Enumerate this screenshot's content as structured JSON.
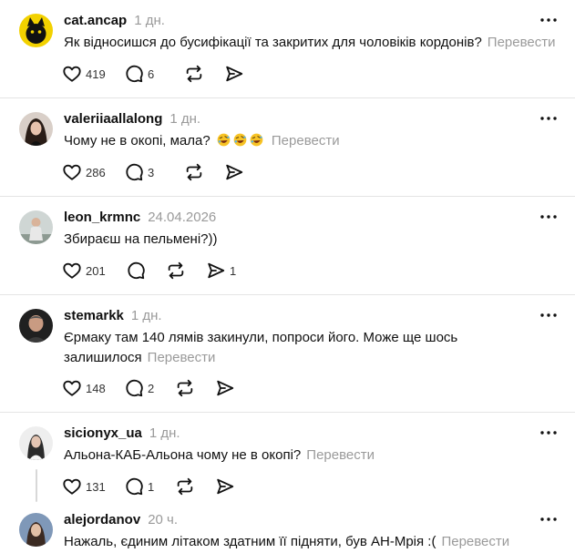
{
  "translate_label": "Перевести",
  "posts": [
    {
      "username": "cat.ancap",
      "time": "1 дн.",
      "text": "Як відносишся до бусифікації та закритих для чоловіків кордонів?",
      "likes": "419",
      "replies": "6",
      "shares": ""
    },
    {
      "username": "valeriiaallalong",
      "time": "1 дн.",
      "text": "Чому не в окопі, мала?",
      "emojis": [
        "rolling-laughing-emoji",
        "rolling-laughing-emoji",
        "rolling-laughing-emoji"
      ],
      "likes": "286",
      "replies": "3",
      "shares": ""
    },
    {
      "username": "leon_krmnc",
      "time": "24.04.2026",
      "text": "Збираєш на пельмені?))",
      "likes": "201",
      "replies": "",
      "shares": "1"
    },
    {
      "username": "stemarkk",
      "time": "1 дн.",
      "text_line1": "Єрмаку там 140 лямів закинули, попроси його. Може ще шось",
      "text_line2": "залишилося",
      "likes": "148",
      "replies": "2",
      "shares": ""
    },
    {
      "username": "sicionyx_ua",
      "time": "1 дн.",
      "text": "Альона-КАБ-Альона чому не в окопі?",
      "likes": "131",
      "replies": "1",
      "shares": ""
    },
    {
      "username": "alejordanov",
      "time": "20 ч.",
      "text": "Нажаль, єдиним літаком здатним її підняти, був АН-Мрія :("
    }
  ],
  "icons": {
    "like": "heart-icon",
    "reply": "comment-bubble-icon",
    "repost": "repost-arrows-icon",
    "share": "send-arrow-icon",
    "more": "more-dots-icon"
  }
}
